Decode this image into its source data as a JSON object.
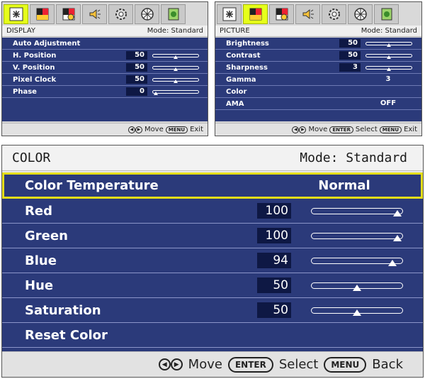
{
  "colors": {
    "tab_active": "#e6ff1a",
    "menu_bg": "#2b3a7a",
    "value_bg": "#0e1844",
    "selection_border": "#e3dd1a"
  },
  "tabs": [
    {
      "name": "display-settings-icon"
    },
    {
      "name": "picture-settings-icon"
    },
    {
      "name": "picture-advanced-icon"
    },
    {
      "name": "audio-icon"
    },
    {
      "name": "system-icon"
    },
    {
      "name": "my-settings-icon"
    },
    {
      "name": "information-icon"
    }
  ],
  "display_panel": {
    "title": "DISPLAY",
    "mode": "Mode: Standard",
    "items": [
      {
        "label": "Auto Adjustment"
      },
      {
        "label": "H. Position",
        "value": "50",
        "level": 0.5
      },
      {
        "label": "V. Position",
        "value": "50",
        "level": 0.5
      },
      {
        "label": "Pixel Clock",
        "value": "50",
        "level": 0.5
      },
      {
        "label": "Phase",
        "value": "0",
        "level": 0.0
      }
    ],
    "footer": {
      "move": "Move",
      "menu": "MENU",
      "exit": "Exit"
    }
  },
  "picture_panel": {
    "title": "PICTURE",
    "mode": "Mode: Standard",
    "items": [
      {
        "label": "Brightness",
        "value": "50",
        "level": 0.5
      },
      {
        "label": "Contrast",
        "value": "50",
        "level": 0.5
      },
      {
        "label": "Sharpness",
        "value": "3",
        "level": 0.5
      },
      {
        "label": "Gamma",
        "value": "3"
      },
      {
        "label": "Color"
      },
      {
        "label": "AMA",
        "value": "OFF"
      }
    ],
    "footer": {
      "move": "Move",
      "enter": "ENTER",
      "select": "Select",
      "menu": "MENU",
      "exit": "Exit"
    }
  },
  "color_panel": {
    "title": "COLOR",
    "mode": "Mode: Standard",
    "items": [
      {
        "label": "Color Temperature",
        "value": "Normal"
      },
      {
        "label": "Red",
        "value": "100",
        "level": 1.0
      },
      {
        "label": "Green",
        "value": "100",
        "level": 1.0
      },
      {
        "label": "Blue",
        "value": "94",
        "level": 0.94
      },
      {
        "label": "Hue",
        "value": "50",
        "level": 0.5
      },
      {
        "label": "Saturation",
        "value": "50",
        "level": 0.5
      },
      {
        "label": "Reset Color"
      }
    ],
    "footer": {
      "move": "Move",
      "enter": "ENTER",
      "select": "Select",
      "menu": "MENU",
      "back": "Back"
    }
  }
}
